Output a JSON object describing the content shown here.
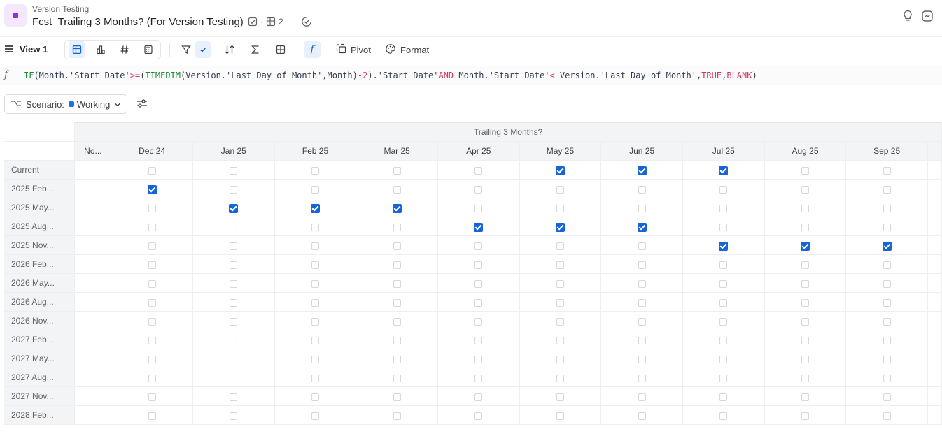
{
  "header": {
    "breadcrumb": "Version Testing",
    "title": "Fcst_Trailing 3 Months? (For Version Testing)",
    "dimension_count": "2"
  },
  "toolbar": {
    "view_label": "View 1",
    "pivot_label": "Pivot",
    "format_label": "Format"
  },
  "formula": {
    "tokens": [
      {
        "t": "IF",
        "c": "fn"
      },
      {
        "t": "(Month.'Start Date'",
        "c": "ref"
      },
      {
        "t": ">=",
        "c": "op"
      },
      {
        "t": "(",
        "c": "ref"
      },
      {
        "t": "TIMEDIM",
        "c": "fn"
      },
      {
        "t": "(Version.'Last Day of Month',Month)",
        "c": "ref"
      },
      {
        "t": "-2",
        "c": "num"
      },
      {
        "t": ").'Start Date'",
        "c": "ref"
      },
      {
        "t": "AND",
        "c": "op"
      },
      {
        "t": " Month.'Start Date'",
        "c": "ref"
      },
      {
        "t": "<",
        "c": "op"
      },
      {
        "t": " Version.'Last Day of Month',",
        "c": "ref"
      },
      {
        "t": "TRUE",
        "c": "op"
      },
      {
        "t": ",",
        "c": "ref"
      },
      {
        "t": "BLANK",
        "c": "op"
      },
      {
        "t": ")",
        "c": "ref"
      }
    ]
  },
  "scenario": {
    "label": "Scenario:",
    "value": "Working",
    "color": "#1a73e8"
  },
  "grid": {
    "group_header": "Trailing 3 Months?",
    "columns": [
      "No...",
      "Dec 24",
      "Jan 25",
      "Feb 25",
      "Mar 25",
      "Apr 25",
      "May 25",
      "Jun 25",
      "Jul 25",
      "Aug 25",
      "Sep 25",
      ""
    ],
    "rows": [
      {
        "label": "Current",
        "checked": [
          6,
          7,
          8
        ]
      },
      {
        "label": "2025 Feb...",
        "checked": [
          1
        ]
      },
      {
        "label": "2025 May...",
        "checked": [
          2,
          3,
          4
        ]
      },
      {
        "label": "2025 Aug...",
        "checked": [
          5,
          6,
          7
        ]
      },
      {
        "label": "2025 Nov...",
        "checked": [
          8,
          9,
          10
        ]
      },
      {
        "label": "2026 Feb...",
        "checked": []
      },
      {
        "label": "2026 May...",
        "checked": []
      },
      {
        "label": "2026 Aug...",
        "checked": []
      },
      {
        "label": "2026 Nov...",
        "checked": []
      },
      {
        "label": "2027 Feb...",
        "checked": []
      },
      {
        "label": "2027 May...",
        "checked": []
      },
      {
        "label": "2027 Aug...",
        "checked": []
      },
      {
        "label": "2027 Nov...",
        "checked": []
      },
      {
        "label": "2028 Feb...",
        "checked": []
      }
    ]
  },
  "colors": {
    "checkbox_checked": "#1565d8",
    "accent": "#1a73e8",
    "app_icon": "#9b2bd6"
  }
}
